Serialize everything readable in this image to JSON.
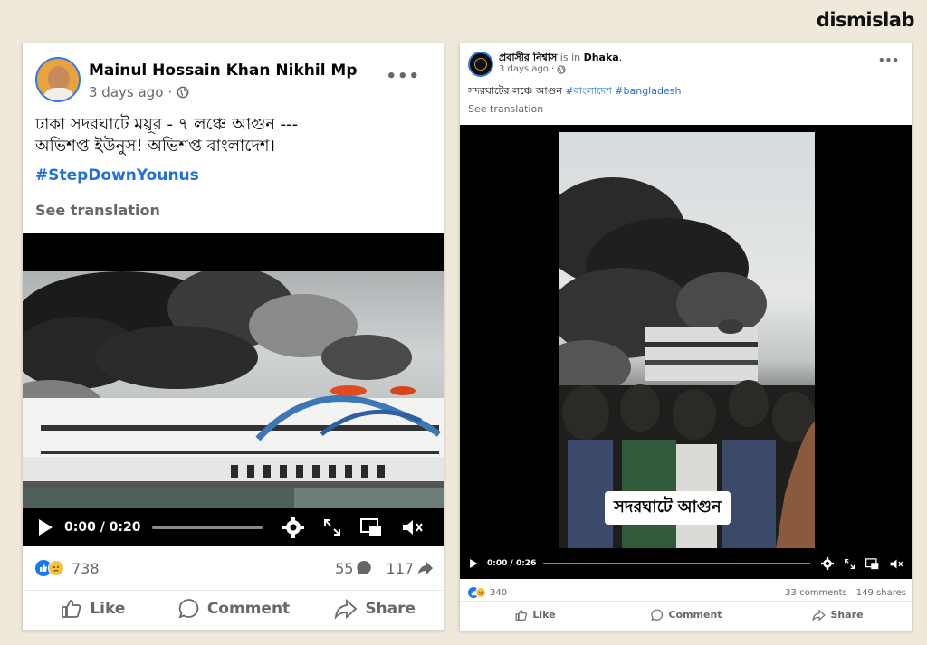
{
  "brand": "dismislab",
  "post_left": {
    "author": "Mainul Hossain Khan Nikhil Mp",
    "time": "3 days ago",
    "text_line1": "ঢাকা সদরঘাটে ময়ূর - ৭ লঞ্চে আগুন ---",
    "text_line2": "অভিশপ্ত ইউনুস! অভিশপ্ত বাংলাদেশ।",
    "hashtag": "#StepDownYounus",
    "see_translation": "See translation",
    "video": {
      "time": "0:00 / 0:20",
      "progress": 0
    },
    "reactions_count": "738",
    "comments_count": "55",
    "shares_count": "117",
    "actions": {
      "like": "Like",
      "comment": "Comment",
      "share": "Share"
    }
  },
  "post_right": {
    "author": "প্রবাসীর নিশ্বাস",
    "is_in": "is in",
    "location": "Dhaka",
    "time": "3 days ago",
    "text": "সদরঘাটের লঞ্চে আগুন",
    "hashtag1": "#বাংলাদেশ",
    "hashtag2": "#bangladesh",
    "see_translation": "See translation",
    "video_caption": "সদরঘাটে আগুন",
    "video": {
      "time": "0:00 / 0:26",
      "progress": 0
    },
    "reactions_count": "340",
    "comments_text": "33 comments",
    "shares_text": "149 shares",
    "actions": {
      "like": "Like",
      "comment": "Comment",
      "share": "Share"
    }
  },
  "colors": {
    "link_blue": "#216fdb",
    "like_blue": "#1877f2",
    "muted": "#65676b",
    "background": "#efe9dc"
  }
}
